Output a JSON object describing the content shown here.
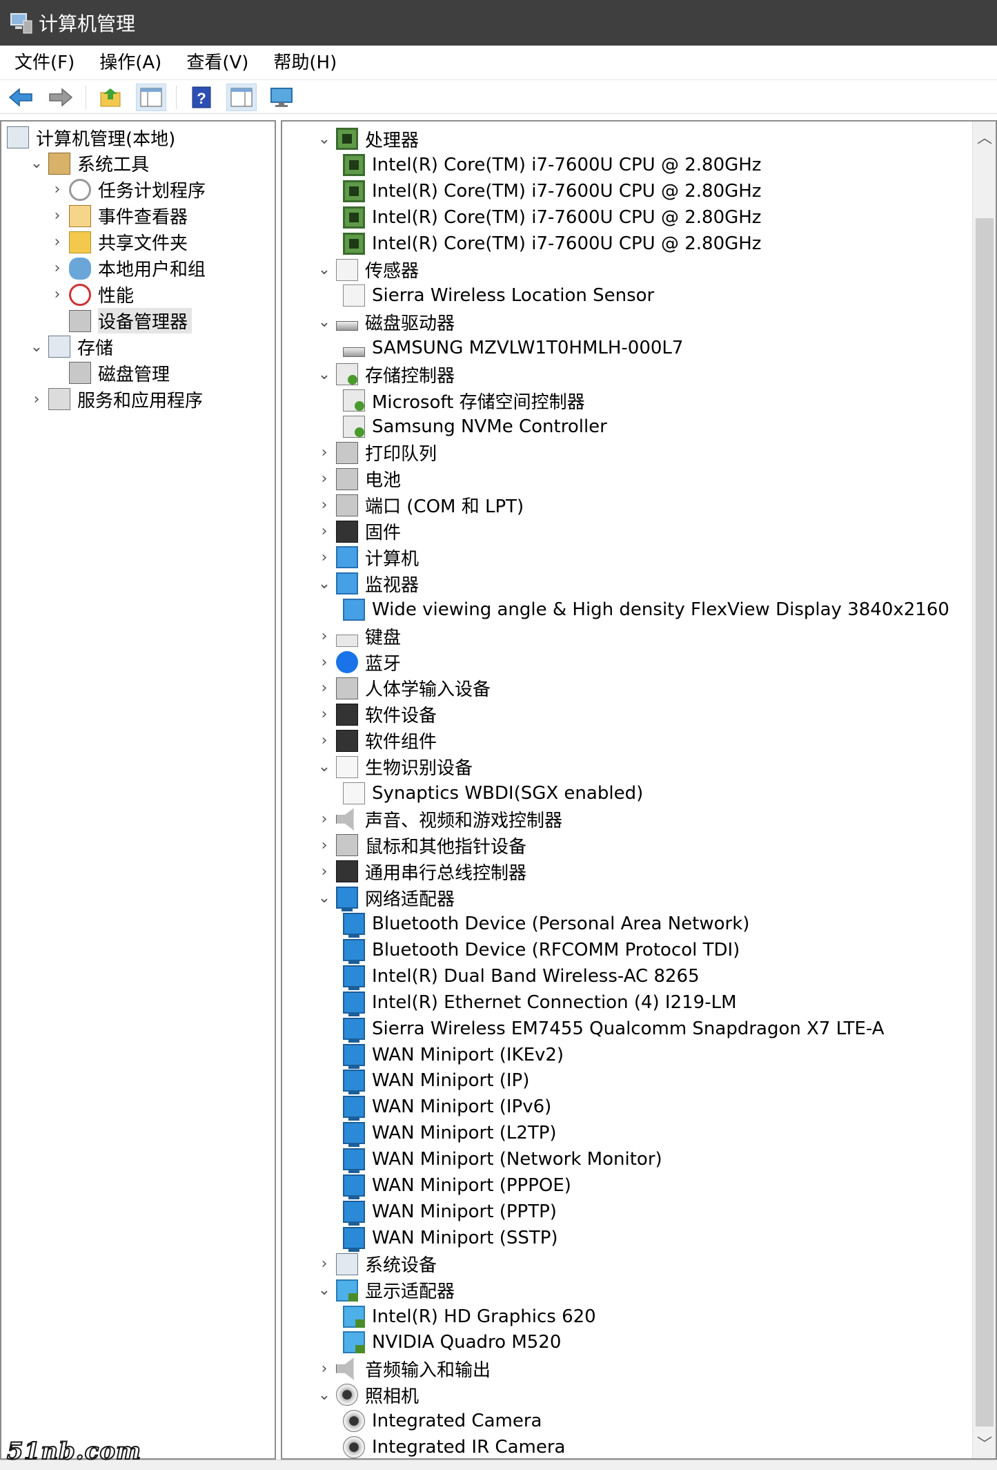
{
  "window": {
    "title": "计算机管理"
  },
  "menu": [
    "文件(F)",
    "操作(A)",
    "查看(V)",
    "帮助(H)"
  ],
  "left_tree": [
    {
      "label": "计算机管理(本地)",
      "depth": 0,
      "expand": "",
      "icon": "computer-management-icon"
    },
    {
      "label": "系统工具",
      "depth": 1,
      "expand": "open",
      "icon": "system-tools-icon"
    },
    {
      "label": "任务计划程序",
      "depth": 2,
      "expand": "closed",
      "icon": "task-scheduler-icon"
    },
    {
      "label": "事件查看器",
      "depth": 2,
      "expand": "closed",
      "icon": "event-viewer-icon"
    },
    {
      "label": "共享文件夹",
      "depth": 2,
      "expand": "closed",
      "icon": "shared-folders-icon"
    },
    {
      "label": "本地用户和组",
      "depth": 2,
      "expand": "closed",
      "icon": "local-users-icon"
    },
    {
      "label": "性能",
      "depth": 2,
      "expand": "closed",
      "icon": "performance-icon"
    },
    {
      "label": "设备管理器",
      "depth": 2,
      "expand": "",
      "icon": "device-manager-icon",
      "selected": true
    },
    {
      "label": "存储",
      "depth": 1,
      "expand": "open",
      "icon": "storage-icon"
    },
    {
      "label": "磁盘管理",
      "depth": 2,
      "expand": "",
      "icon": "disk-management-icon"
    },
    {
      "label": "服务和应用程序",
      "depth": 1,
      "expand": "closed",
      "icon": "services-apps-icon"
    }
  ],
  "devices": [
    {
      "label": "处理器",
      "depth": 0,
      "expand": "open",
      "icon": "cpu"
    },
    {
      "label": "Intel(R) Core(TM) i7-7600U CPU @ 2.80GHz",
      "depth": 1,
      "icon": "cpu"
    },
    {
      "label": "Intel(R) Core(TM) i7-7600U CPU @ 2.80GHz",
      "depth": 1,
      "icon": "cpu"
    },
    {
      "label": "Intel(R) Core(TM) i7-7600U CPU @ 2.80GHz",
      "depth": 1,
      "icon": "cpu"
    },
    {
      "label": "Intel(R) Core(TM) i7-7600U CPU @ 2.80GHz",
      "depth": 1,
      "icon": "cpu"
    },
    {
      "label": "传感器",
      "depth": 0,
      "expand": "open",
      "icon": "sensor"
    },
    {
      "label": "Sierra Wireless Location Sensor",
      "depth": 1,
      "icon": "sensor"
    },
    {
      "label": "磁盘驱动器",
      "depth": 0,
      "expand": "open",
      "icon": "disk"
    },
    {
      "label": "SAMSUNG MZVLW1T0HMLH-000L7",
      "depth": 1,
      "icon": "disk"
    },
    {
      "label": "存储控制器",
      "depth": 0,
      "expand": "open",
      "icon": "stor"
    },
    {
      "label": "Microsoft 存储空间控制器",
      "depth": 1,
      "icon": "stor"
    },
    {
      "label": "Samsung NVMe Controller",
      "depth": 1,
      "icon": "stor"
    },
    {
      "label": "打印队列",
      "depth": 0,
      "expand": "closed",
      "icon": "gray"
    },
    {
      "label": "电池",
      "depth": 0,
      "expand": "closed",
      "icon": "gray"
    },
    {
      "label": "端口 (COM 和 LPT)",
      "depth": 0,
      "expand": "closed",
      "icon": "gray"
    },
    {
      "label": "固件",
      "depth": 0,
      "expand": "closed",
      "icon": "dark"
    },
    {
      "label": "计算机",
      "depth": 0,
      "expand": "closed",
      "icon": "monitor"
    },
    {
      "label": "监视器",
      "depth": 0,
      "expand": "open",
      "icon": "monitor"
    },
    {
      "label": "Wide viewing angle & High density FlexView Display 3840x2160",
      "depth": 1,
      "icon": "monitor"
    },
    {
      "label": "键盘",
      "depth": 0,
      "expand": "closed",
      "icon": "kb"
    },
    {
      "label": "蓝牙",
      "depth": 0,
      "expand": "closed",
      "icon": "bt"
    },
    {
      "label": "人体学输入设备",
      "depth": 0,
      "expand": "closed",
      "icon": "gray"
    },
    {
      "label": "软件设备",
      "depth": 0,
      "expand": "closed",
      "icon": "dark"
    },
    {
      "label": "软件组件",
      "depth": 0,
      "expand": "closed",
      "icon": "dark"
    },
    {
      "label": "生物识别设备",
      "depth": 0,
      "expand": "open",
      "icon": "bio"
    },
    {
      "label": "Synaptics WBDI(SGX enabled)",
      "depth": 1,
      "icon": "bio"
    },
    {
      "label": "声音、视频和游戏控制器",
      "depth": 0,
      "expand": "closed",
      "icon": "audio"
    },
    {
      "label": "鼠标和其他指针设备",
      "depth": 0,
      "expand": "closed",
      "icon": "gray"
    },
    {
      "label": "通用串行总线控制器",
      "depth": 0,
      "expand": "closed",
      "icon": "dark"
    },
    {
      "label": "网络适配器",
      "depth": 0,
      "expand": "open",
      "icon": "net"
    },
    {
      "label": "Bluetooth Device (Personal Area Network)",
      "depth": 1,
      "icon": "net"
    },
    {
      "label": "Bluetooth Device (RFCOMM Protocol TDI)",
      "depth": 1,
      "icon": "net"
    },
    {
      "label": "Intel(R) Dual Band Wireless-AC 8265",
      "depth": 1,
      "icon": "net"
    },
    {
      "label": "Intel(R) Ethernet Connection (4) I219-LM",
      "depth": 1,
      "icon": "net"
    },
    {
      "label": "Sierra Wireless EM7455 Qualcomm Snapdragon X7 LTE-A",
      "depth": 1,
      "icon": "net"
    },
    {
      "label": "WAN Miniport (IKEv2)",
      "depth": 1,
      "icon": "net"
    },
    {
      "label": "WAN Miniport (IP)",
      "depth": 1,
      "icon": "net"
    },
    {
      "label": "WAN Miniport (IPv6)",
      "depth": 1,
      "icon": "net"
    },
    {
      "label": "WAN Miniport (L2TP)",
      "depth": 1,
      "icon": "net"
    },
    {
      "label": "WAN Miniport (Network Monitor)",
      "depth": 1,
      "icon": "net"
    },
    {
      "label": "WAN Miniport (PPPOE)",
      "depth": 1,
      "icon": "net"
    },
    {
      "label": "WAN Miniport (PPTP)",
      "depth": 1,
      "icon": "net"
    },
    {
      "label": "WAN Miniport (SSTP)",
      "depth": 1,
      "icon": "net"
    },
    {
      "label": "系统设备",
      "depth": 0,
      "expand": "closed",
      "icon": "comp"
    },
    {
      "label": "显示适配器",
      "depth": 0,
      "expand": "open",
      "icon": "display"
    },
    {
      "label": "Intel(R) HD Graphics 620",
      "depth": 1,
      "icon": "display"
    },
    {
      "label": "NVIDIA Quadro M520",
      "depth": 1,
      "icon": "display"
    },
    {
      "label": "音频输入和输出",
      "depth": 0,
      "expand": "closed",
      "icon": "audio"
    },
    {
      "label": "照相机",
      "depth": 0,
      "expand": "open",
      "icon": "cam"
    },
    {
      "label": "Integrated Camera",
      "depth": 1,
      "icon": "cam"
    },
    {
      "label": "Integrated IR Camera",
      "depth": 1,
      "icon": "cam"
    }
  ],
  "watermark": "51nb.com"
}
